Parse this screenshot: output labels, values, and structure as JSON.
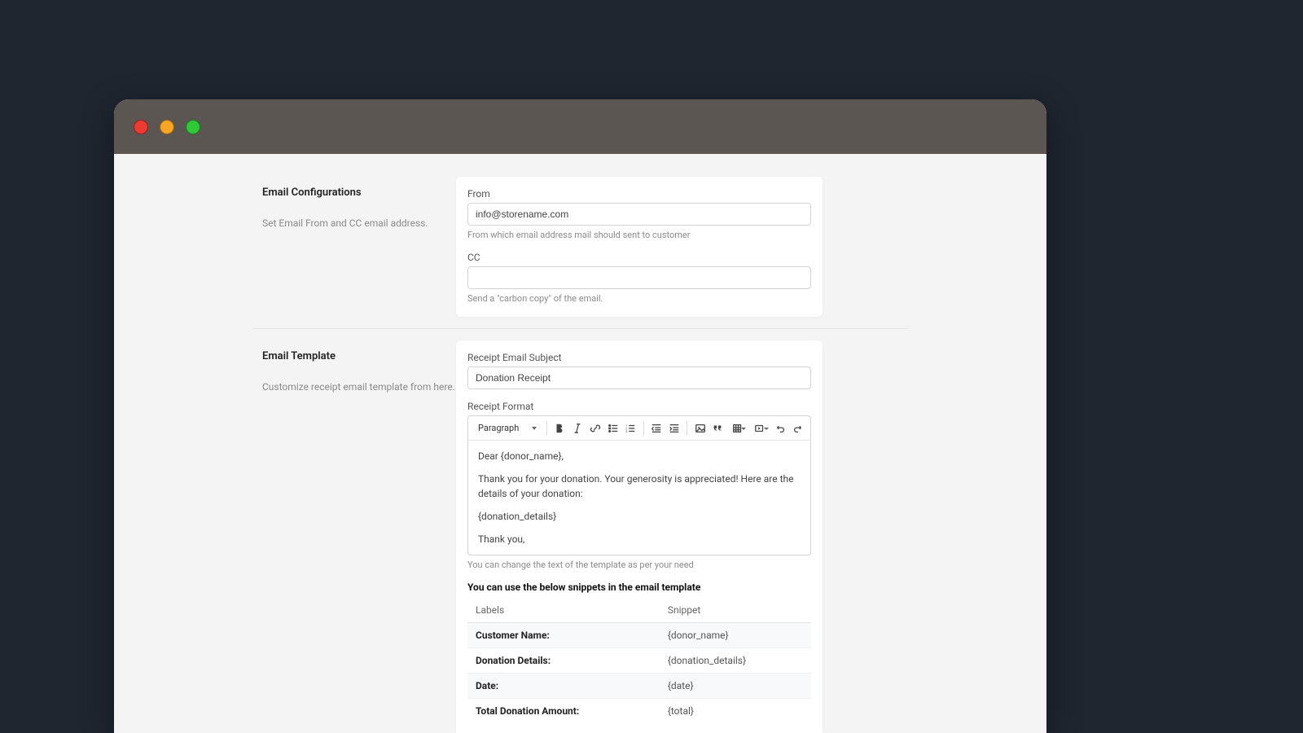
{
  "sections": {
    "emailConfig": {
      "title": "Email Configurations",
      "description": "Set Email From and CC email address.",
      "from": {
        "label": "From",
        "value": "info@storename.com",
        "help": "From which email address mail should sent to customer"
      },
      "cc": {
        "label": "CC",
        "value": "",
        "help": "Send a \"carbon copy\" of the email."
      }
    },
    "emailTemplate": {
      "title": "Email Template",
      "description": "Customize receipt email template from here.",
      "subject": {
        "label": "Receipt Email Subject",
        "value": "Donation Receipt"
      },
      "format": {
        "label": "Receipt Format",
        "help": "You can change the text of the template as per your need"
      },
      "toolbar": {
        "paragraph": "Paragraph"
      },
      "body": {
        "line1": "Dear {donor_name},",
        "line2": "Thank you for your donation. Your generosity is appreciated! Here are the details of your donation:",
        "line3": "{donation_details}",
        "line4": "Thank you,"
      },
      "snippets": {
        "heading": "You can use the below snippets in the email template",
        "colLabels": "Labels",
        "colSnippet": "Snippet",
        "rows": [
          {
            "label": "Customer Name:",
            "snippet": "{donor_name}"
          },
          {
            "label": "Donation Details:",
            "snippet": "{donation_details}"
          },
          {
            "label": "Date:",
            "snippet": "{date}"
          },
          {
            "label": "Total Donation Amount:",
            "snippet": "{total}"
          }
        ]
      }
    }
  }
}
